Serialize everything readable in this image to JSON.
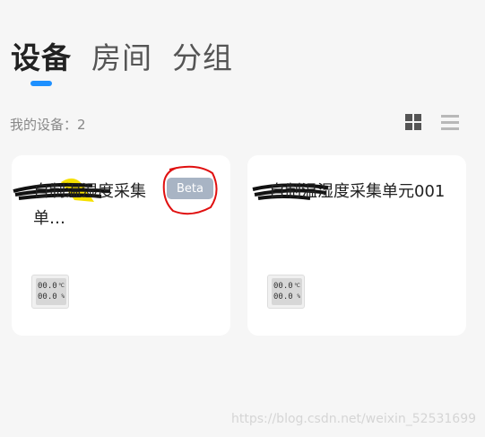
{
  "tabs": [
    {
      "label": "设备",
      "active": true
    },
    {
      "label": "房间",
      "active": false
    },
    {
      "label": "分组",
      "active": false
    }
  ],
  "device_count": {
    "label": "我的设备：",
    "value": "2"
  },
  "view_toggle": {
    "grid_icon": "grid-view-icon",
    "list_icon": "list-view-icon"
  },
  "devices": [
    {
      "title": "自制温湿度采集单…",
      "badge": "Beta",
      "icon": "thermo-hygrometer-icon"
    },
    {
      "title": "自制温湿度采集单元001",
      "badge": "",
      "icon": "thermo-hygrometer-icon"
    }
  ],
  "display": {
    "temp": "00.0",
    "humidity": "00.0",
    "temp_unit": "℃",
    "humidity_unit": "%"
  },
  "watermark": "https://blog.csdn.net/weixin_52531699",
  "colors": {
    "accent": "#1e90ff",
    "beta_bg": "#a8b4c4",
    "annotation_red": "#e01010",
    "annotation_yellow": "#f6e000"
  }
}
